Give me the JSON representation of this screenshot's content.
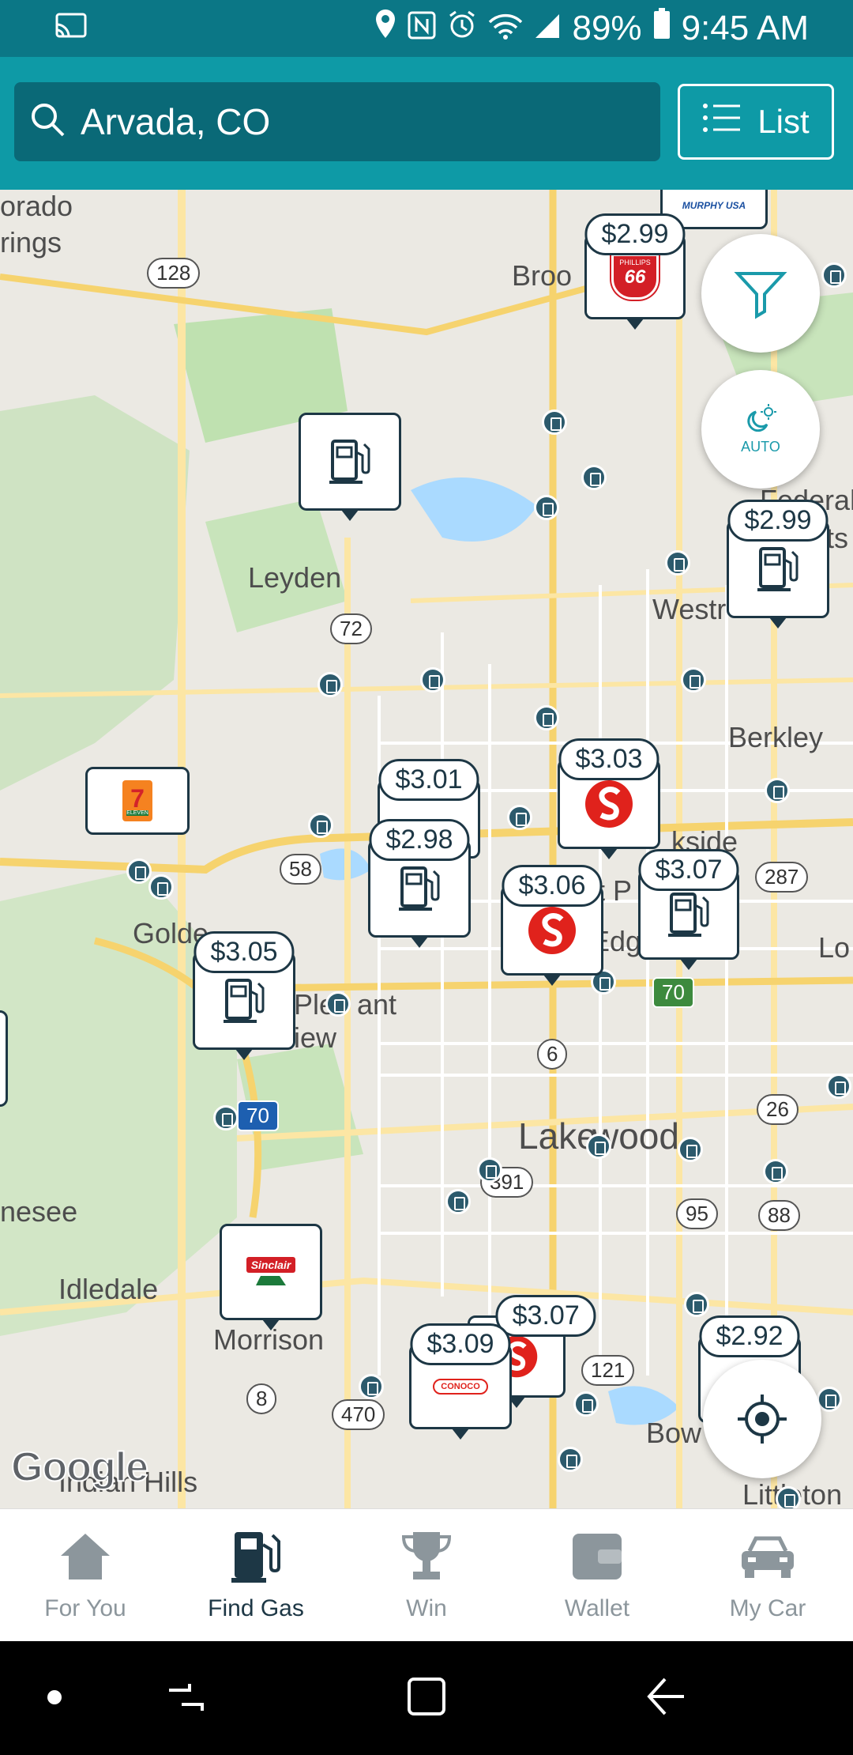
{
  "status_bar": {
    "battery": "89%",
    "time": "9:45 AM"
  },
  "search": {
    "value": "Arvada, CO"
  },
  "list_button": {
    "label": "List"
  },
  "fab": {
    "auto_label": "AUTO"
  },
  "map": {
    "places": [
      "orado",
      "rings",
      "Broo",
      "Federal",
      "Leyden",
      "Westr",
      "Berkley",
      "Golde",
      "Ple",
      "ant",
      "iew",
      "Lake",
      "wood",
      "nesee",
      "Idledale",
      "Morrison",
      "Bow",
      "Littleton",
      "Indian Hills",
      "ts",
      "kside",
      "it P",
      "Edg",
      "Lo"
    ],
    "routes": [
      "128",
      "72",
      "58",
      "287",
      "6",
      "70",
      "26",
      "95",
      "88",
      "391",
      "121",
      "8",
      "470",
      "70"
    ],
    "prices": [
      "$2.99",
      "$2.99",
      "$3.03",
      "$3.01",
      "$2.98",
      "$3.06",
      "$3.07",
      "$3.05",
      "$3.09",
      "$3.07",
      "$2.92"
    ],
    "brands": [
      "PHILLIPS",
      "66",
      "MURPHY USA",
      "7",
      "ELEVEN",
      "Sinclair",
      "CONOCO"
    ],
    "attribution": "Google"
  },
  "tabs": [
    {
      "label": "For You",
      "icon": "house-icon"
    },
    {
      "label": "Find Gas",
      "icon": "gas-pump-icon"
    },
    {
      "label": "Win",
      "icon": "trophy-icon"
    },
    {
      "label": "Wallet",
      "icon": "wallet-icon"
    },
    {
      "label": "My Car",
      "icon": "car-icon"
    }
  ],
  "colors": {
    "status": "#0b7786",
    "appbar": "#0e9aa6",
    "search": "#0a6977",
    "marker": "#1d3745",
    "active_tab": "#1d3745",
    "inactive_tab": "#8c969c"
  }
}
